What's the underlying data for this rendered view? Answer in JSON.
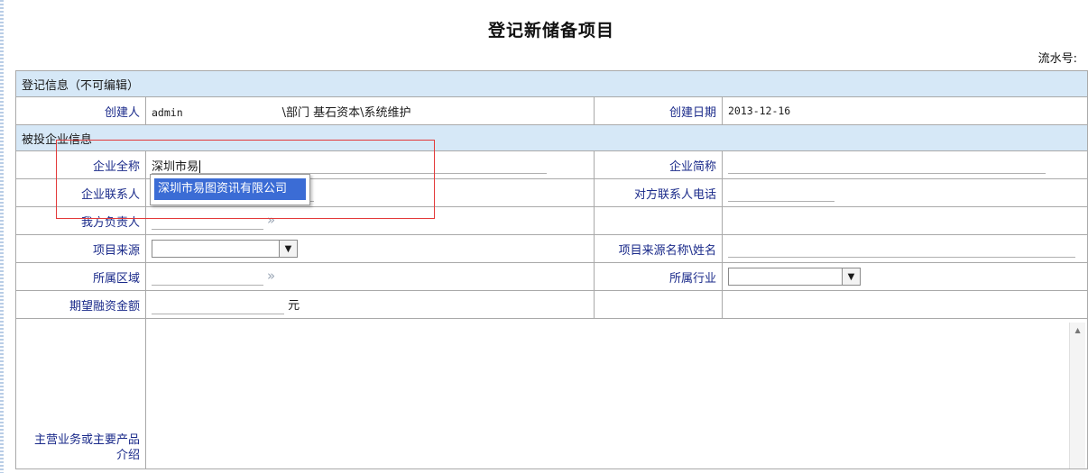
{
  "page": {
    "title": "登记新储备项目",
    "serial_label": "流水号:",
    "serial_value": ""
  },
  "sections": {
    "registration": "登记信息（不可编辑）",
    "company": "被投企业信息"
  },
  "registration": {
    "creator_label": "创建人",
    "creator_value": "admin",
    "department_value": "\\部门 基石资本\\系统维护",
    "date_label": "创建日期",
    "date_value": "2013-12-16"
  },
  "company": {
    "full_name_label": "企业全称",
    "full_name_value": "深圳市易",
    "short_name_label": "企业简称",
    "short_name_value": "",
    "contact_label": "企业联系人",
    "contact_value": "",
    "contact_phone_label": "对方联系人电话",
    "contact_phone_value": "",
    "owner_label": "我方负责人",
    "owner_value": "",
    "source_label": "项目来源",
    "source_value": "",
    "source_name_label": "项目来源名称\\姓名",
    "source_name_value": "",
    "region_label": "所属区域",
    "region_value": "",
    "industry_label": "所属行业",
    "industry_value": "",
    "financing_label": "期望融资金额",
    "financing_value": "",
    "financing_unit": "元",
    "business_label_line1": "主营业务或主要产品",
    "business_label_line2": "介绍",
    "business_value": ""
  },
  "autocomplete": {
    "options": [
      "深圳市易图资讯有限公司"
    ]
  },
  "icons": {
    "picker": "double-chevron-right-icon",
    "dropdown": "chevron-down-icon",
    "scroll_up": "triangle-up-icon"
  },
  "colors": {
    "section_bg": "#d6e8f7",
    "label_text": "#1a2a8a",
    "highlight": "#e33a3a",
    "selected_option": "#3b6cd5"
  }
}
